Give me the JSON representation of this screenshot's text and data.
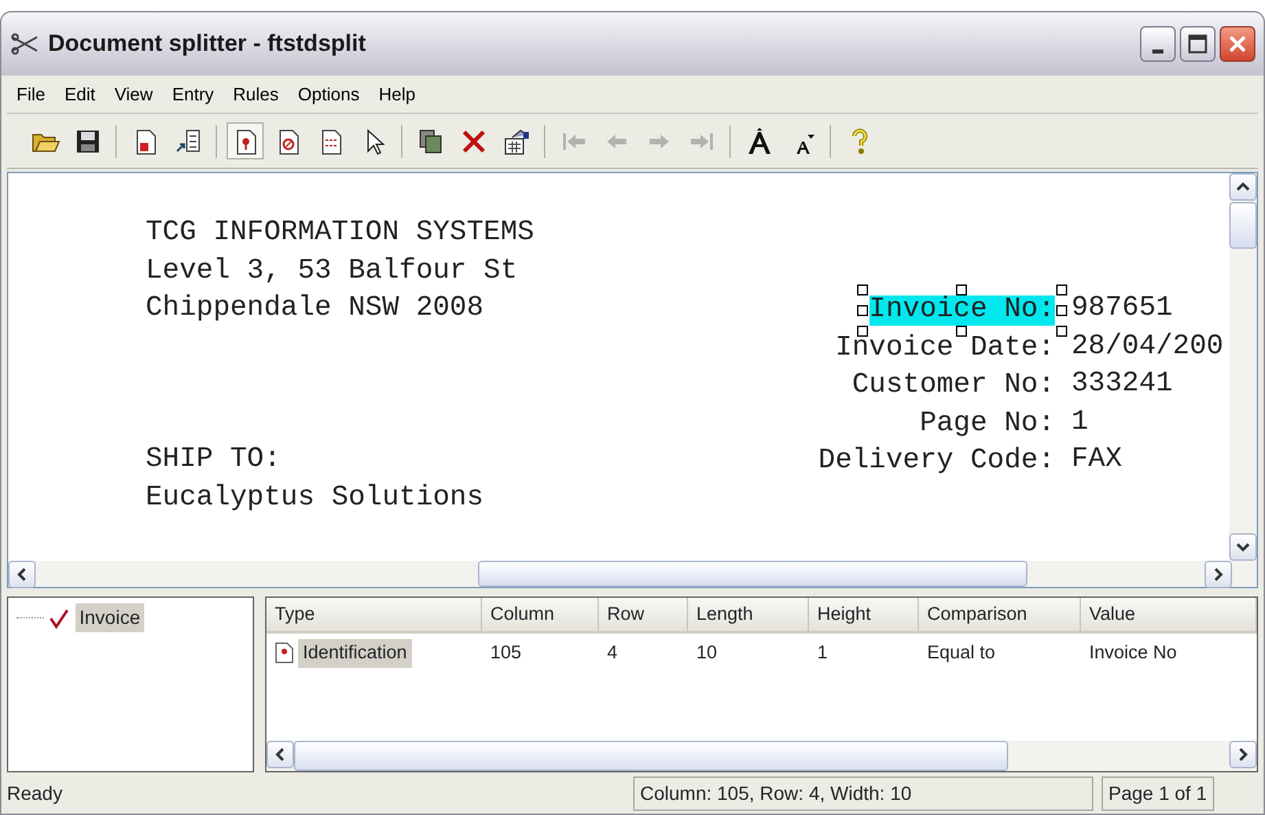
{
  "window": {
    "title": "Document splitter - ftstdsplit"
  },
  "menu": [
    "File",
    "Edit",
    "View",
    "Entry",
    "Rules",
    "Options",
    "Help"
  ],
  "toolbar": [
    {
      "pressed": false,
      "disabled": false
    },
    {
      "pressed": false,
      "disabled": false
    },
    {
      "pressed": false,
      "disabled": false
    },
    {
      "pressed": false,
      "disabled": false
    },
    {
      "pressed": true,
      "disabled": false
    },
    {
      "pressed": false,
      "disabled": false
    },
    {
      "pressed": false,
      "disabled": false
    },
    {
      "pressed": false,
      "disabled": false
    },
    {
      "pressed": false,
      "disabled": false
    },
    {
      "pressed": false,
      "disabled": false
    },
    {
      "pressed": false,
      "disabled": false
    },
    {
      "pressed": false,
      "disabled": true
    },
    {
      "pressed": false,
      "disabled": true
    },
    {
      "pressed": false,
      "disabled": true
    },
    {
      "pressed": false,
      "disabled": true
    },
    {
      "pressed": false,
      "disabled": false
    },
    {
      "pressed": false,
      "disabled": false
    },
    {
      "pressed": false,
      "disabled": false
    }
  ],
  "document": {
    "rows": [
      {
        "text": "TCG INFORMATION SYSTEMS"
      },
      {
        "text": "Level 3, 53 Balfour St"
      },
      {
        "text": "Chippendale NSW 2008",
        "field": {
          "label": "Invoice No:",
          "value": "987651",
          "selected": true
        }
      },
      {
        "field": {
          "label": "Invoice Date:",
          "value": "28/04/200",
          "selected": false
        }
      },
      {
        "field": {
          "label": "Customer No:",
          "value": "333241",
          "selected": false
        }
      },
      {
        "field": {
          "label": "Page No:",
          "value": "1",
          "selected": false
        }
      },
      {
        "text": "SHIP TO:",
        "field": {
          "label": "Delivery Code:",
          "value": "FAX",
          "selected": false
        }
      },
      {
        "text": "Eucalyptus Solutions"
      }
    ]
  },
  "tree": [
    {
      "label": "Invoice",
      "checked": true,
      "selected": true
    }
  ],
  "table": {
    "columns": [
      "Type",
      "Column",
      "Row",
      "Length",
      "Height",
      "Comparison",
      "Value"
    ],
    "rows": [
      {
        "cells": [
          "Identification",
          "105",
          "4",
          "10",
          "1",
          "Equal to",
          "Invoice No"
        ],
        "selected": true
      }
    ]
  },
  "status_bar": [
    "Ready",
    "Column: 105, Row: 4, Width: 10",
    "Page 1 of 1"
  ]
}
